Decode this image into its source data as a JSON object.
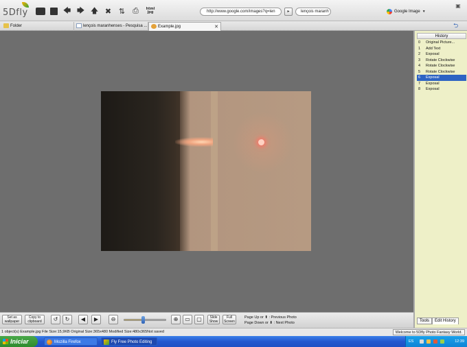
{
  "app": {
    "logo_text": "5Dfly"
  },
  "toolbar": {
    "icons": [
      "screen-icon",
      "save-icon",
      "back-arrow-icon",
      "forward-arrow-icon",
      "up-arrow-icon",
      "delete-icon",
      "refresh-icon",
      "print-icon",
      "html-icon"
    ],
    "html_label": "html\njpg"
  },
  "browser": {
    "url": "http://www.google.com/images?q=len",
    "go_label": "▸",
    "search_value": "lençois maranh",
    "search_engine": "Google Image"
  },
  "tabs": [
    {
      "label": "Folder",
      "icon": "folder-icon"
    },
    {
      "label": "lençois maranhenses - Pesquisa ...",
      "icon": "page-icon"
    },
    {
      "label": "Example.jpg",
      "icon": "image-icon",
      "active": true
    }
  ],
  "history": {
    "header": "History",
    "items": [
      {
        "n": "0",
        "label": "Original Picture..."
      },
      {
        "n": "1",
        "label": "Add Text"
      },
      {
        "n": "2",
        "label": "Exposal"
      },
      {
        "n": "3",
        "label": "Rotate Clockwise"
      },
      {
        "n": "4",
        "label": "Rotate Clockwise"
      },
      {
        "n": "5",
        "label": "Rotate Clockwise"
      },
      {
        "n": "6",
        "label": "Exposal",
        "selected": true
      },
      {
        "n": "7",
        "label": "Exposal"
      },
      {
        "n": "8",
        "label": "Exposal"
      }
    ],
    "tabs": [
      "Tools",
      "Edit History"
    ]
  },
  "bottom": {
    "set_wallpaper": "Set as wallpaper",
    "copy_clipboard": "Copy to clipboard",
    "slide_show": "Slide Show",
    "full_screen": "Full Screen",
    "zoom_level": 0.45,
    "hint_prev": "Page Up or ⬆ : Previous Photo",
    "hint_next": "Page Down or ⬇ : Next Photo"
  },
  "status": {
    "left": "1 object(s)    Example.jpg   File Size:15,9KB   Original Size:365x480   Modified Size:480x365Not saved",
    "right": "Welcome to 5Dfly Photo Fantasy World."
  },
  "taskbar": {
    "start_label": "Iniciar",
    "tasks": [
      {
        "label": "Mozilla Firefox",
        "icon": "firefox-icon"
      },
      {
        "label": "Fly Free Photo Editing",
        "icon": "5dfly-icon",
        "active": true
      }
    ],
    "lang": "ES",
    "clock": "12:39"
  },
  "colors": {
    "selection": "#2d63c3",
    "canvas": "#6e6e6e",
    "panel": "#eef0c8",
    "taskbar": "#2458cf"
  }
}
